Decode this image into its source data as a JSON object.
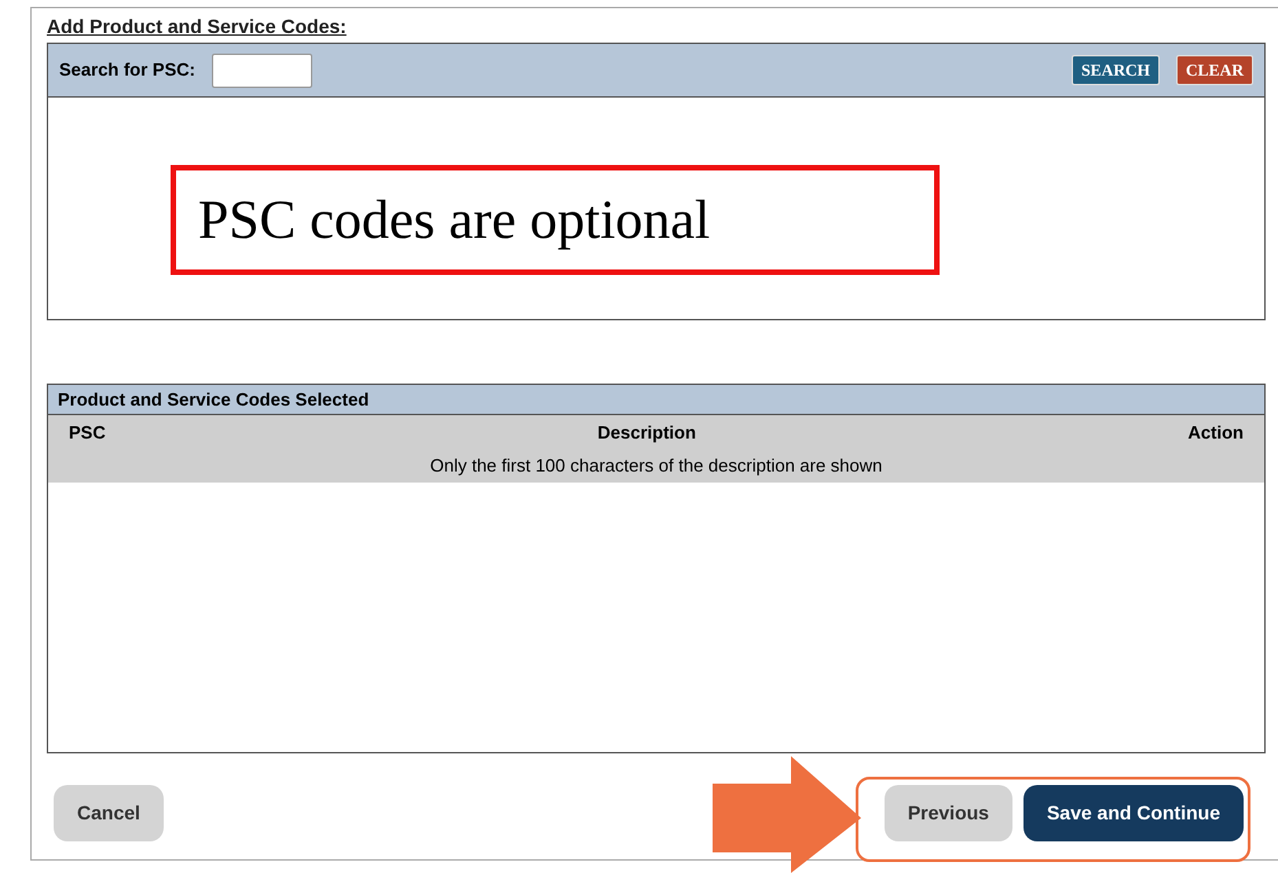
{
  "title": "Add Product and Service Codes:",
  "search": {
    "label": "Search for PSC:",
    "buttons": [
      {
        "label": "SEARCH",
        "kind": "search"
      },
      {
        "label": "CLEAR",
        "kind": "clear"
      }
    ]
  },
  "annotation": {
    "text": "PSC codes are optional"
  },
  "selected_panel": {
    "title": "Product and Service Codes Selected",
    "columns": [
      "PSC",
      "Description",
      "Action"
    ],
    "note": "Only the first 100 characters of the description are shown"
  },
  "footer": {
    "buttons": [
      {
        "label": "Cancel",
        "kind": "secondary"
      },
      {
        "label": "Previous",
        "kind": "secondary"
      },
      {
        "label": "Save and Continue",
        "kind": "primary"
      }
    ]
  }
}
